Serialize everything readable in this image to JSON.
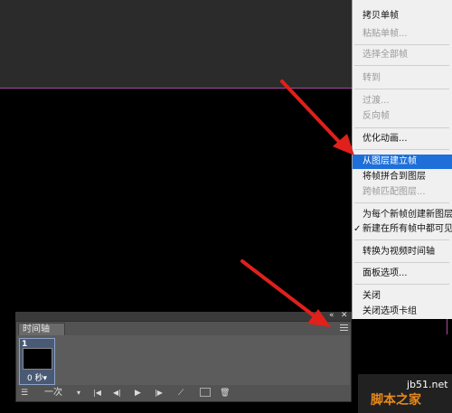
{
  "context_menu": {
    "items": [
      {
        "label": "拷贝单帧",
        "disabled": false
      },
      {
        "label": "粘贴单帧...",
        "disabled": true
      },
      {
        "label": "选择全部帧",
        "disabled": true
      },
      {
        "label": "转到",
        "disabled": true
      },
      {
        "label": "过渡...",
        "disabled": true
      },
      {
        "label": "反向帧",
        "disabled": true
      },
      {
        "label": "优化动画...",
        "disabled": false
      },
      {
        "label": "从图层建立帧",
        "disabled": false,
        "highlighted": true
      },
      {
        "label": "将帧拼合到图层",
        "disabled": false
      },
      {
        "label": "跨帧匹配图层...",
        "disabled": true
      },
      {
        "label": "为每个新帧创建新图层",
        "disabled": false
      },
      {
        "label": "新建在所有帧中都可见",
        "disabled": false,
        "checked": true
      },
      {
        "label": "转换为视频时间轴",
        "disabled": false
      },
      {
        "label": "面板选项...",
        "disabled": false
      },
      {
        "label": "关闭",
        "disabled": false
      },
      {
        "label": "关闭选项卡组",
        "disabled": false
      }
    ],
    "checkmark": "✓"
  },
  "timeline": {
    "tab_label": "时间轴",
    "collapse_icon": "«",
    "close_icon": "✕",
    "frames": [
      {
        "number": "1",
        "delay": "0 秒▾"
      }
    ],
    "loop": "一次",
    "loop_arrow": "▾"
  },
  "watermark": {
    "url": "jb51.net",
    "site": "脚本之家"
  },
  "colors": {
    "highlight": "#1e6fd9",
    "arrow": "#e0201b",
    "guide": "#b0479e"
  }
}
